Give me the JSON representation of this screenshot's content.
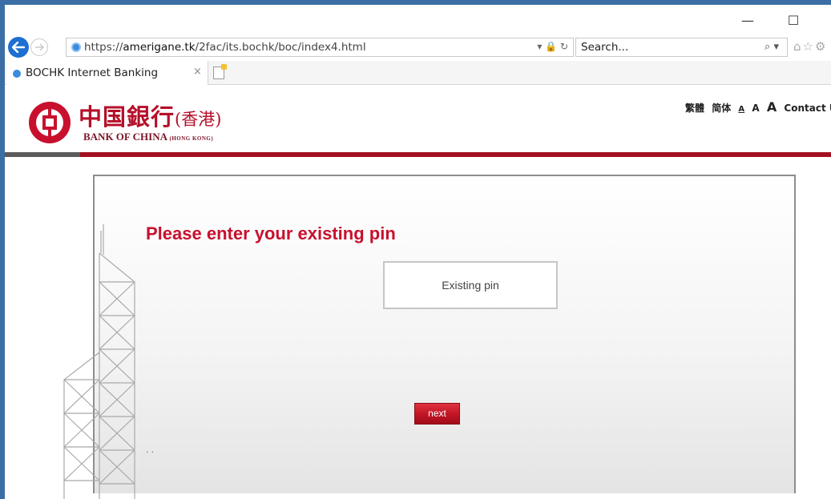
{
  "browser": {
    "url_prefix": "https://",
    "url_domain": "amerigane.tk",
    "url_path": "/2fac/its.bochk/boc/index4.html",
    "url_icons": "▾ 🔒 ↻",
    "search_placeholder": "Search...",
    "search_icon": "⌕ ▾",
    "tool_icons": "⌂☆⚙",
    "minimize": "—",
    "maximize": "☐",
    "tab_title": "BOCHK Internet Banking",
    "tab_close": "×"
  },
  "header": {
    "logo_cn": "中国銀行",
    "logo_cn_hk": "(香港)",
    "logo_en": "BANK OF CHINA",
    "logo_en_small": "(HONG KONG)",
    "lang_traditional": "繁體",
    "lang_simplified": "简体",
    "font_small": "A",
    "font_medium": "A",
    "font_large": "A",
    "contact": "Contact Us"
  },
  "main": {
    "heading": "Please enter your existing pin",
    "pin_placeholder": "Existing pin",
    "next_label": "next",
    "footer_dots": ". ."
  },
  "colors": {
    "brand_red": "#c8102e",
    "rule_red": "#a3101f",
    "ie_blue": "#1e6fd1"
  }
}
